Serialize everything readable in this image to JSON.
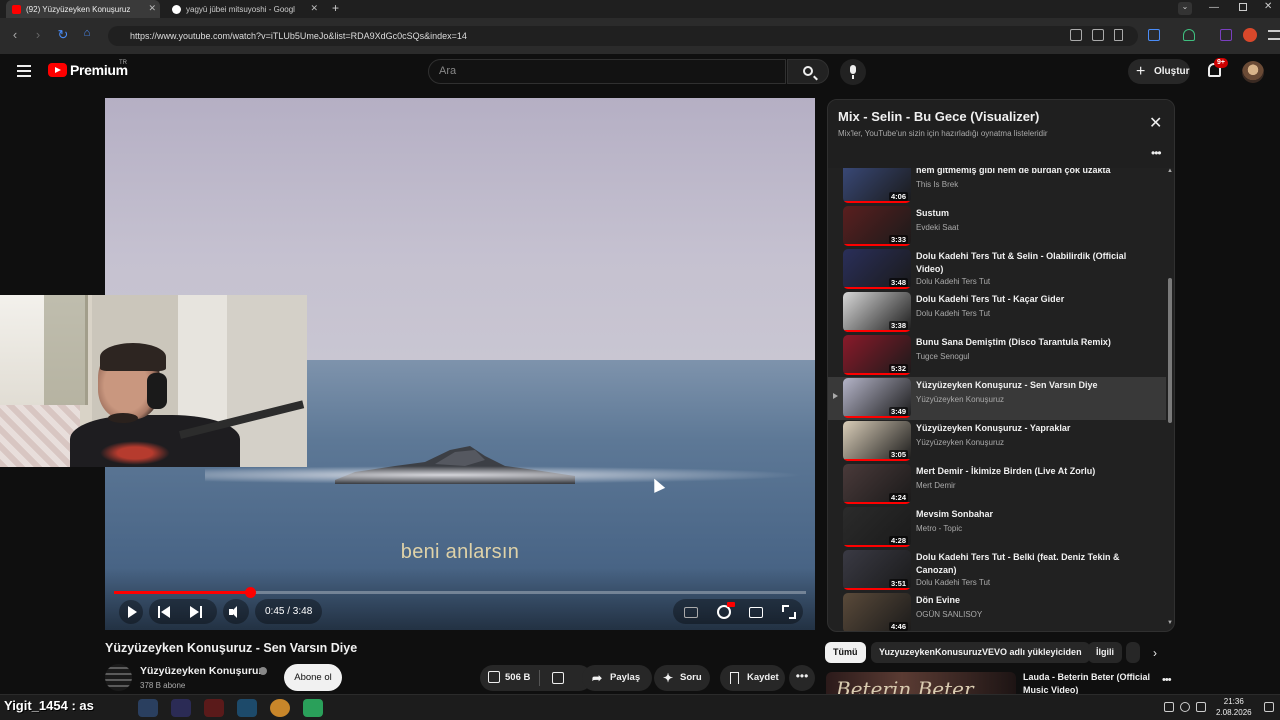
{
  "browser": {
    "tabs": [
      {
        "title": "(92) Yüzyüzeyken Konuşuruz",
        "active": true
      },
      {
        "title": "yagyū jūbei mitsuyoshi - Googl",
        "active": false
      }
    ],
    "new_tab": "+",
    "url": "https://www.youtube.com/watch?v=iTLUb5UmeJo&list=RDA9XdGc0cSQs&index=14"
  },
  "header": {
    "brand": "Premium",
    "country": "TR",
    "search_placeholder": "Ara",
    "create_label": "Oluştur",
    "notification_count": "9+"
  },
  "player": {
    "lyric": "beni anlarsın",
    "time": "0:45 / 3:48",
    "progress_fraction": 0.197
  },
  "video": {
    "title": "Yüzyüzeyken Konuşuruz - Sen Varsın Diye",
    "channel": "Yüzyüzeyken Konuşuruz",
    "subscribers": "378 B abone",
    "subscribe_label": "Abone ol",
    "likes": "506 B",
    "share_label": "Paylaş",
    "ask_label": "Soru",
    "save_label": "Kaydet"
  },
  "playlist": {
    "title": "Mix - Selin - Bu Gece (Visualizer)",
    "subtitle": "Mix'ler, YouTube'un sizin için hazırladığı oynatma listeleridir",
    "items": [
      {
        "title": "hem gitmemiş gibi hem de burdan çok uzakta",
        "channel": "This Is Brek",
        "duration": "4:06",
        "active": false
      },
      {
        "title": "Sustum",
        "channel": "Evdeki Saat",
        "duration": "3:33",
        "active": false
      },
      {
        "title": "Dolu Kadehi Ters Tut & Selin - Olabilirdik (Official Video)",
        "channel": "Dolu Kadehi Ters Tut",
        "duration": "3:48",
        "active": false
      },
      {
        "title": "Dolu Kadehi Ters Tut - Kaçar Gider",
        "channel": "Dolu Kadehi Ters Tut",
        "duration": "3:38",
        "active": false
      },
      {
        "title": "Bunu Sana Demiştim (Disco Tarantula Remix)",
        "channel": "Tugce Senogul",
        "duration": "5:32",
        "active": false
      },
      {
        "title": "Yüzyüzeyken Konuşuruz - Sen Varsın Diye",
        "channel": "Yüzyüzeyken Konuşuruz",
        "duration": "3:49",
        "active": true
      },
      {
        "title": "Yüzyüzeyken Konuşuruz - Yapraklar",
        "channel": "Yüzyüzeyken Konuşuruz",
        "duration": "3:05",
        "active": false
      },
      {
        "title": "Mert Demir - İkimize Birden (Live At Zorlu)",
        "channel": "Mert Demir",
        "duration": "4:24",
        "active": false
      },
      {
        "title": "Mevsim Sonbahar",
        "channel": "Metro - Topic",
        "duration": "4:28",
        "active": false
      },
      {
        "title": "Dolu Kadehi Ters Tut - Belki (feat. Deniz Tekin & Canozan)",
        "channel": "Dolu Kadehi Ters Tut",
        "duration": "3:51",
        "active": false
      },
      {
        "title": "Dön Evine",
        "channel": "OGÜN SANLISOY",
        "duration": "4:46",
        "active": false
      }
    ]
  },
  "chips": [
    "Tümü",
    "YuzyuzeykenKonusuruzVEVO adlı yükleyiciden",
    "İlgili"
  ],
  "recommendation": {
    "thumb_text": "Beterin Beter",
    "title": "Lauda - Beterin Beter (Official Music Video)"
  },
  "taskbar": {
    "overlay_text": "Yigit_1454 : as",
    "time": "21:36",
    "date": "2.08.2026"
  },
  "colors": {
    "accent": "#ff0000",
    "background": "#0f0f0f",
    "panel": "#212121"
  }
}
